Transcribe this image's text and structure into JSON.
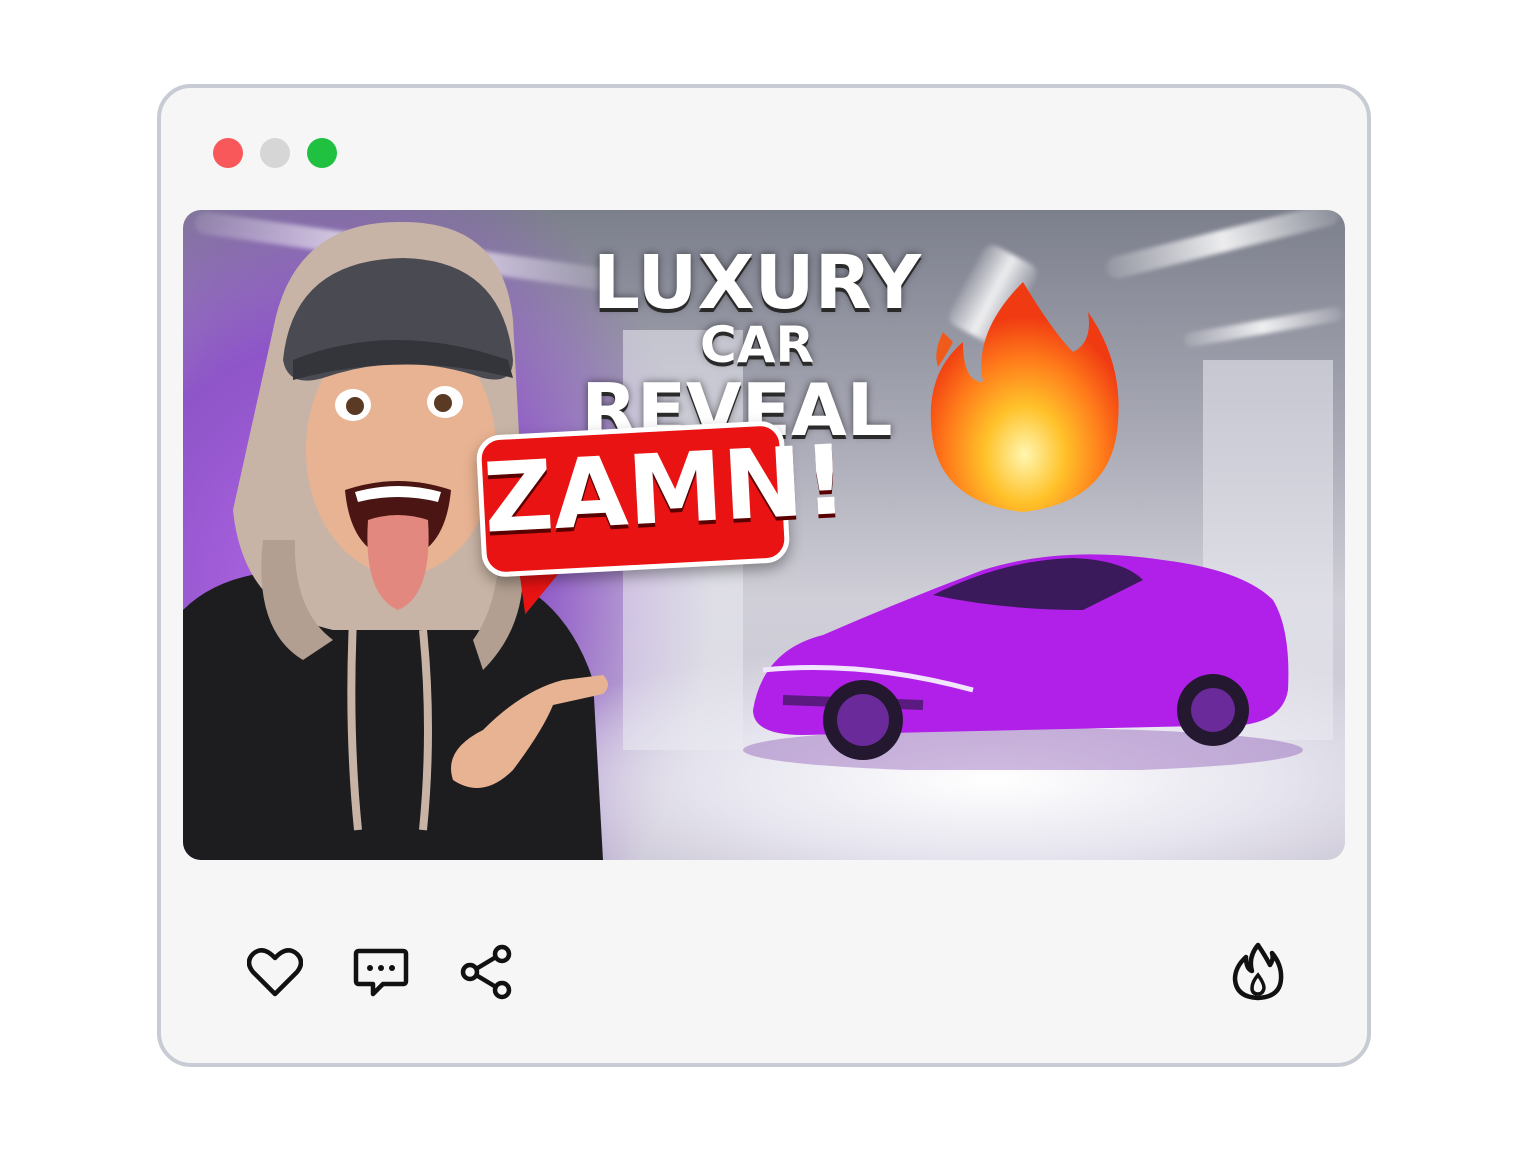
{
  "window": {
    "controls": [
      "close",
      "minimize",
      "maximize"
    ]
  },
  "thumbnail": {
    "headline_word1": "LUXURY",
    "headline_word2": "CAR",
    "headline_line2": "REVEAL",
    "bubble_text": "ZAMN!",
    "emoji": "fire-emoji",
    "car_color": "#b020e8",
    "bubble_color": "#ea1313"
  },
  "actions": {
    "like_icon": "heart-icon",
    "comment_icon": "comment-icon",
    "share_icon": "share-icon",
    "hot_icon": "flame-icon"
  }
}
